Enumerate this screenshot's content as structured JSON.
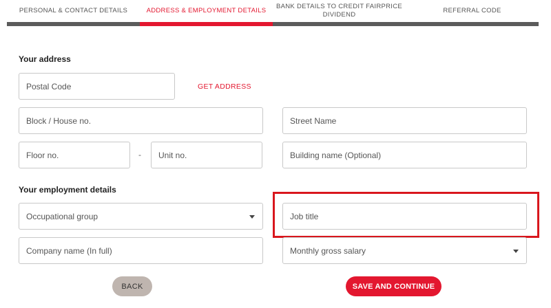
{
  "tabs": [
    {
      "label": "PERSONAL & CONTACT DETAILS",
      "active": false
    },
    {
      "label": "ADDRESS & EMPLOYMENT DETAILS",
      "active": true
    },
    {
      "label": "BANK DETAILS TO CREDIT FAIRPRICE DIVIDEND",
      "active": false
    },
    {
      "label": "REFERRAL CODE",
      "active": false
    }
  ],
  "colors": {
    "accent": "#e3172f",
    "tab_bar": "#5b5b5b",
    "highlight": "#d9161d",
    "back_button": "#bfb5af"
  },
  "address": {
    "title": "Your address",
    "postal_code": "Postal Code",
    "get_address": "GET ADDRESS",
    "block_house": "Block / House no.",
    "street_name": "Street Name",
    "floor": "Floor no.",
    "separator": "-",
    "unit": "Unit no.",
    "building": "Building name (Optional)"
  },
  "employment": {
    "title": "Your employment details",
    "occupational_group": "Occupational group",
    "job_title": "Job title",
    "company_name": "Company name (In full)",
    "monthly_salary": "Monthly gross salary"
  },
  "actions": {
    "back": "BACK",
    "save": "SAVE AND CONTINUE"
  }
}
